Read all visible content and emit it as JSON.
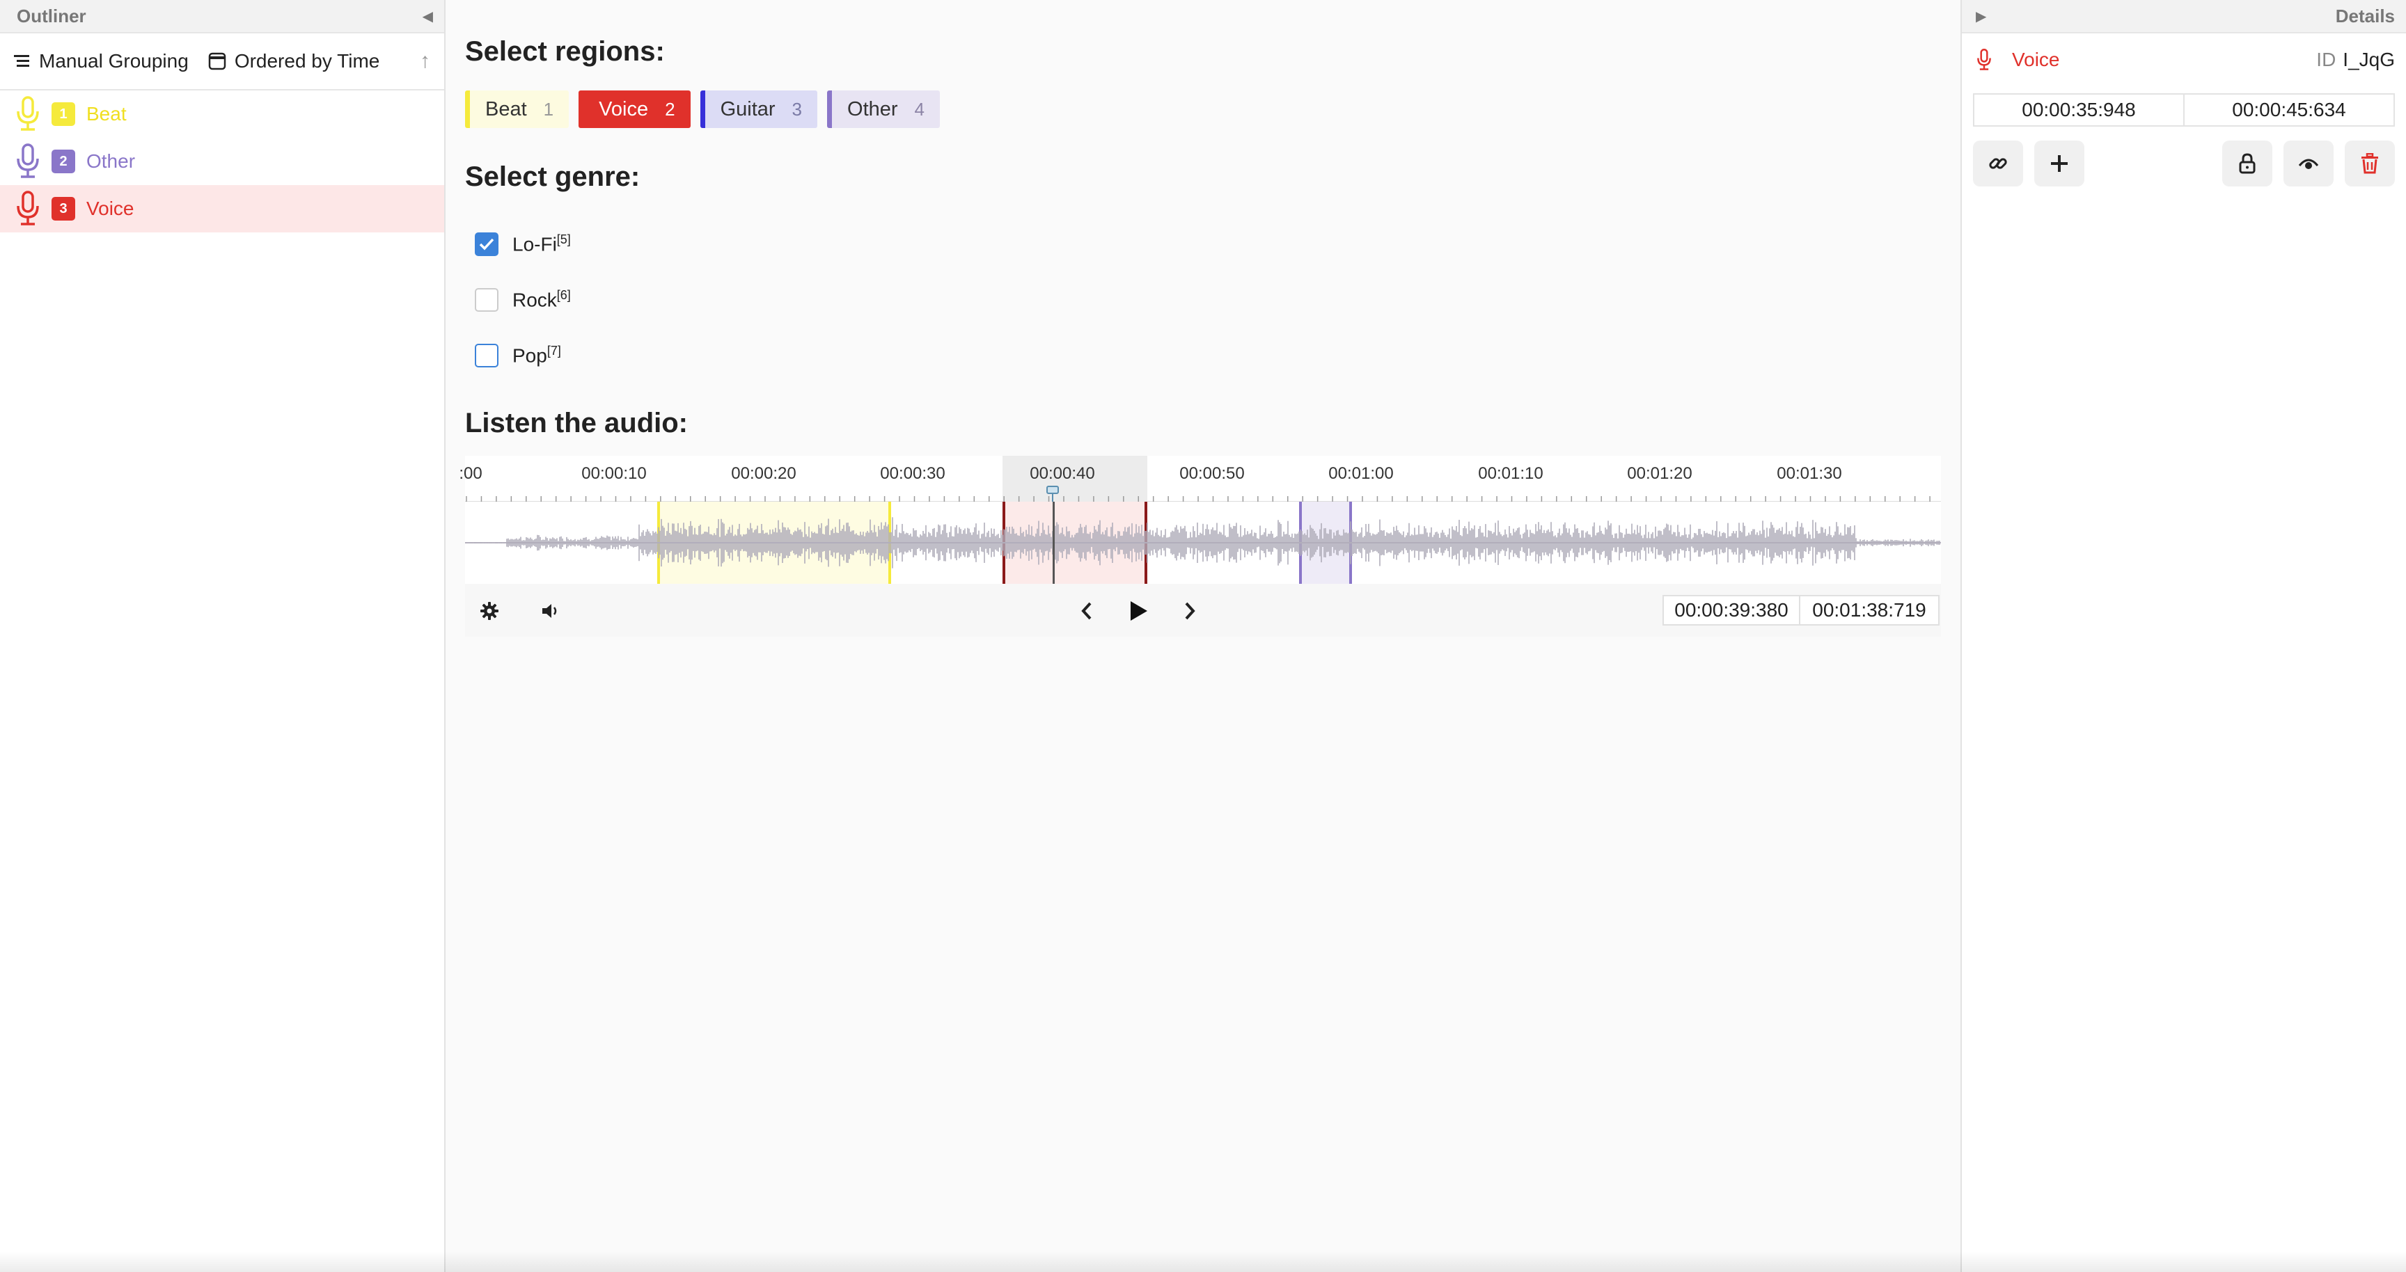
{
  "outliner": {
    "title": "Outliner",
    "toolbar": {
      "grouping_label": "Manual Grouping",
      "ordering_label": "Ordered by Time"
    },
    "items": [
      {
        "index": "1",
        "label": "Beat",
        "color": "#f5ea3c"
      },
      {
        "index": "2",
        "label": "Other",
        "color": "#8a76c9"
      },
      {
        "index": "3",
        "label": "Voice",
        "color": "#e0312b"
      }
    ]
  },
  "main": {
    "regions_title": "Select regions:",
    "regions": [
      {
        "label": "Beat",
        "key": "1",
        "color": "#f5ea3c"
      },
      {
        "label": "Voice",
        "key": "2",
        "color": "#e0312b"
      },
      {
        "label": "Guitar",
        "key": "3",
        "color": "#3730d9"
      },
      {
        "label": "Other",
        "key": "4",
        "color": "#8a76c9"
      }
    ],
    "genre_title": "Select genre:",
    "genres": [
      {
        "label": "Lo-Fi",
        "key": "[5]",
        "checked": true
      },
      {
        "label": "Rock",
        "key": "[6]",
        "checked": false
      },
      {
        "label": "Pop",
        "key": "[7]",
        "checked": false
      }
    ],
    "audio_title": "Listen the audio:",
    "audio": {
      "tick_labels": [
        ":00",
        "00:00:10",
        "00:00:20",
        "00:00:30",
        "00:00:40",
        "00:00:50",
        "00:01:00",
        "00:01:10",
        "00:01:20",
        "00:01:30"
      ],
      "current_time": "00:00:39:380",
      "duration": "00:01:38:719"
    }
  },
  "details": {
    "title": "Details",
    "region_label": "Voice",
    "id_prefix": "ID",
    "id_value": "I_JqG",
    "start_time": "00:00:35:948",
    "end_time": "00:00:45:634"
  },
  "icons": {
    "grouping": "list-icon",
    "ordering": "calendar-icon",
    "sort": "arrow-up-icon",
    "region": "microphone-icon",
    "settings": "gear-icon",
    "volume": "speaker-icon",
    "prev": "chevron-left-icon",
    "play": "play-icon",
    "next": "chevron-right-icon",
    "link": "link-icon",
    "add": "plus-icon",
    "lock": "lock-icon",
    "visibility": "eye-icon",
    "delete": "trash-icon"
  }
}
